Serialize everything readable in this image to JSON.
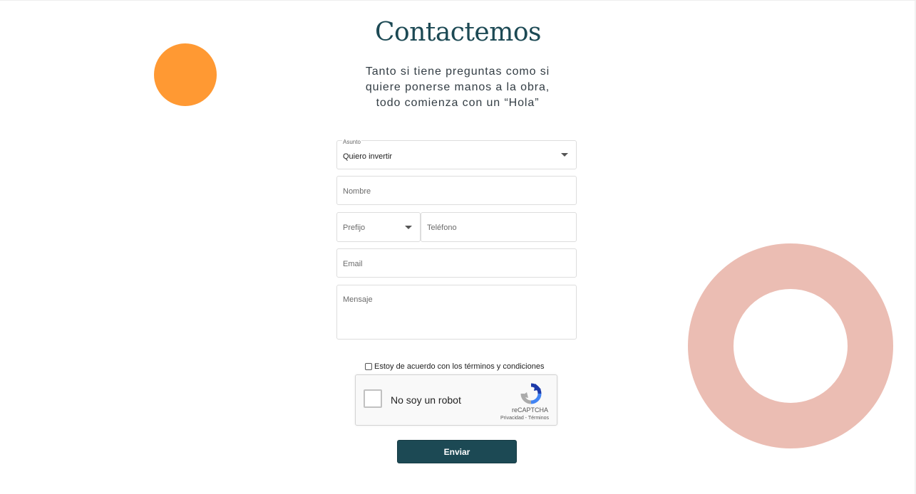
{
  "header": {
    "title": "Contactemos",
    "subtitle_line1": "Tanto si tiene preguntas como si",
    "subtitle_line2": "quiere ponerse manos a la obra,",
    "subtitle_line3": "todo comienza con un “Hola”"
  },
  "form": {
    "subject": {
      "label": "Asunto",
      "value": "Quiero invertir"
    },
    "name": {
      "placeholder": "Nombre"
    },
    "prefix": {
      "placeholder": "Prefijo"
    },
    "phone": {
      "placeholder": "Teléfono"
    },
    "email": {
      "placeholder": "Email"
    },
    "message": {
      "placeholder": "Mensaje"
    },
    "terms_label": "Estoy de acuerdo con los términos y condiciones",
    "submit_label": "Enviar"
  },
  "captcha": {
    "label": "No soy un robot",
    "brand": "reCAPTCHA",
    "links": "Privacidad - Términos"
  },
  "colors": {
    "brand": "#1c4954",
    "orange_circle": "#ff9933",
    "pink_ring": "#ebbdb3"
  },
  "icons": {
    "select_caret": "chevron-down-icon",
    "captcha_logo": "recaptcha-icon"
  }
}
